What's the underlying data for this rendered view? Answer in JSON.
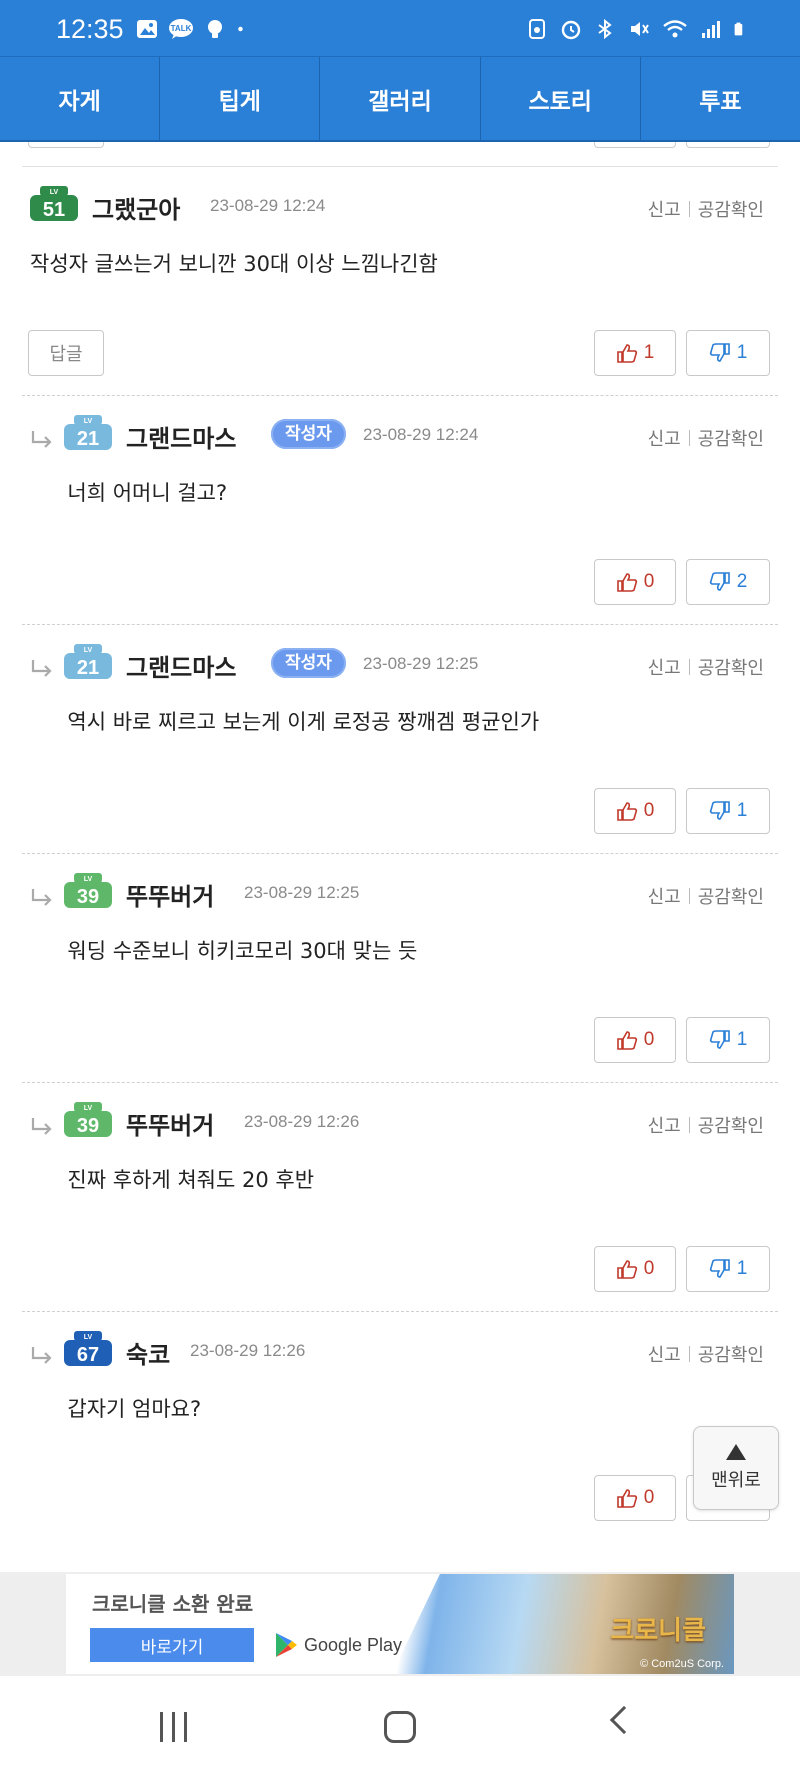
{
  "status": {
    "time": "12:35",
    "talk_badge": "TALK"
  },
  "tabs": [
    {
      "label": "자게"
    },
    {
      "label": "팁게"
    },
    {
      "label": "갤러리"
    },
    {
      "label": "스토리"
    },
    {
      "label": "투표"
    }
  ],
  "labels": {
    "report": "신고",
    "empathy": "공감확인",
    "reply": "답글",
    "author_badge": "작성자",
    "to_top": "맨위로"
  },
  "comments": [
    {
      "level": "51",
      "level_color": "#2e8b4a",
      "nickname": "그랬군아",
      "is_author": false,
      "is_reply": false,
      "date": "23-08-29 12:24",
      "text": "작성자 글쓰는거 보니깐 30대 이상 느낌나긴함",
      "likes": "1",
      "dislikes": "1"
    },
    {
      "level": "21",
      "level_color": "#7ab9de",
      "nickname": "그랜드마스",
      "is_author": true,
      "is_reply": true,
      "date": "23-08-29 12:24",
      "text": "너희 어머니 걸고?",
      "likes": "0",
      "dislikes": "2"
    },
    {
      "level": "21",
      "level_color": "#7ab9de",
      "nickname": "그랜드마스",
      "is_author": true,
      "is_reply": true,
      "date": "23-08-29 12:25",
      "text": "역시 바로 찌르고 보는게 이게 로정공 짱깨겜 평균인가",
      "likes": "0",
      "dislikes": "1"
    },
    {
      "level": "39",
      "level_color": "#5fb86a",
      "nickname": "뚜뚜버거",
      "is_author": false,
      "is_reply": true,
      "date": "23-08-29 12:25",
      "text": "워딩 수준보니 히키코모리 30대 맞는 듯",
      "likes": "0",
      "dislikes": "1"
    },
    {
      "level": "39",
      "level_color": "#5fb86a",
      "nickname": "뚜뚜버거",
      "is_author": false,
      "is_reply": true,
      "date": "23-08-29 12:26",
      "text": "진짜 후하게 쳐줘도 20 후반",
      "likes": "0",
      "dislikes": "1"
    },
    {
      "level": "67",
      "level_color": "#1f5fb5",
      "nickname": "숙코",
      "is_author": false,
      "is_reply": true,
      "date": "23-08-29 12:26",
      "text": "갑자기 엄마요?",
      "likes": "0",
      "dislikes": ""
    }
  ],
  "ad": {
    "title": "크로니클 소환 완료",
    "cta": "바로가기",
    "store": "Google Play",
    "logo": "크로니클",
    "copyright": "© Com2uS Corp."
  }
}
